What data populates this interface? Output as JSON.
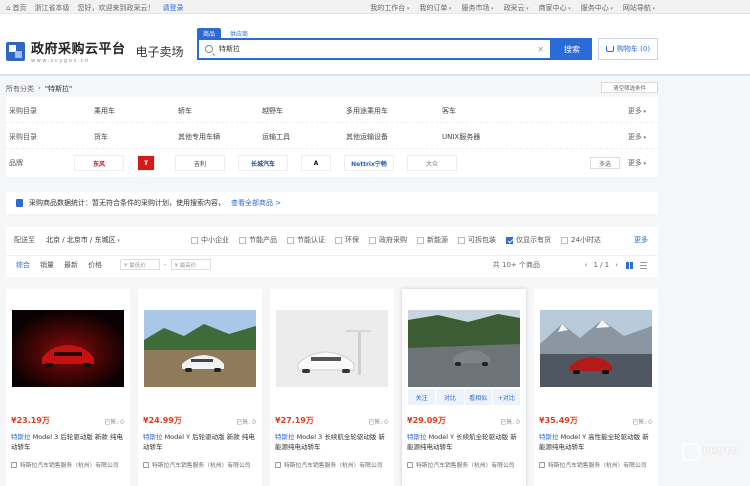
{
  "topbar": {
    "home": "首页",
    "region": "浙江省本级",
    "welcome": "您好，欢迎来到政采云！",
    "login": "请登录",
    "links": [
      "我的工作台",
      "我的订单",
      "服务市场",
      "政采云",
      "商家中心",
      "服务中心",
      "网站导航"
    ]
  },
  "header": {
    "logo_title": "政府采购云平台",
    "logo_url": "www.zcygov.cn",
    "logo_sub": "电子卖场",
    "search_tabs": [
      "商品",
      "供应商"
    ],
    "search_value": "特斯拉",
    "search_button": "搜索",
    "cart_label": "购物车 (0)"
  },
  "breadcrumb": {
    "root": "所有分类",
    "query": "\"特斯拉\""
  },
  "clear_filter": "清空筛选条件",
  "filters": {
    "row1": {
      "label": "采购目录",
      "items": [
        "乘用车",
        "轿车",
        "越野车",
        "多用途乘用车",
        "客车"
      ],
      "more": "更多"
    },
    "row2": {
      "label": "采购目录",
      "items": [
        "货车",
        "其他专用车辆",
        "运输工具",
        "其他运输设备",
        "UNIX服务器"
      ],
      "more": "更多"
    },
    "brands": {
      "label": "品牌",
      "items": [
        "东风",
        "T",
        "吉利",
        "长城汽车",
        "A",
        "Nettrix宁畅",
        "大众"
      ],
      "multi": "多选",
      "more": "更多"
    }
  },
  "notice": {
    "text": "采购商品数据统计：暂无符合条件的采购计划，使用搜索内容，",
    "link": "查看全部商品 >"
  },
  "toolbar": {
    "region_label": "配送至",
    "region_value": "北京 / 北京市 / 东城区",
    "checkboxes": [
      {
        "label": "中小企业",
        "checked": false
      },
      {
        "label": "节能产品",
        "checked": false
      },
      {
        "label": "节能认证",
        "checked": false
      },
      {
        "label": "环保",
        "checked": false
      },
      {
        "label": "政府采购",
        "checked": false
      },
      {
        "label": "新能源",
        "checked": false
      },
      {
        "label": "可拆包装",
        "checked": false
      },
      {
        "label": "仅显示有货",
        "checked": true
      },
      {
        "label": "24小时达",
        "checked": false
      }
    ],
    "more": "更多",
    "sort": [
      "综合",
      "销量",
      "最新",
      "价格"
    ],
    "price_min": "¥ 最低价",
    "price_max": "¥ 最高价",
    "dash": "-",
    "count": "共 10+ 个商品",
    "pager": "1 / 1"
  },
  "products": [
    {
      "price": "¥23.19万",
      "sold": "已售: 0",
      "brand": "特斯拉",
      "title": " Model 3 后轮驱动版 新款 纯电动轿车",
      "seller": "特斯拉汽车销售服务（杭州）有限公司"
    },
    {
      "price": "¥24.99万",
      "sold": "已售: 0",
      "brand": "特斯拉",
      "title": " Model Y 后轮驱动版 新款 纯电动轿车",
      "seller": "特斯拉汽车销售服务（杭州）有限公司"
    },
    {
      "price": "¥27.19万",
      "sold": "已售: 0",
      "brand": "特斯拉",
      "title": " Model 3 长续航全轮驱动版 新能源纯电动轿车",
      "seller": "特斯拉汽车销售服务（杭州）有限公司"
    },
    {
      "price": "¥29.09万",
      "sold": "已售: 0",
      "brand": "特斯拉",
      "title": " Model Y 长续航全轮驱动版 新能源纯电动轿车",
      "seller": "特斯拉汽车销售服务（杭州）有限公司",
      "actions": [
        "关注",
        "对比",
        "看相似",
        "+对比"
      ]
    },
    {
      "price": "¥35.49万",
      "sold": "已售: 0",
      "brand": "特斯拉",
      "title": " Model Y 高性能全轮驱动版 新能源纯电动轿车",
      "seller": "特斯拉汽车销售服务（杭州）有限公司"
    }
  ],
  "watermark": "PHOTO"
}
